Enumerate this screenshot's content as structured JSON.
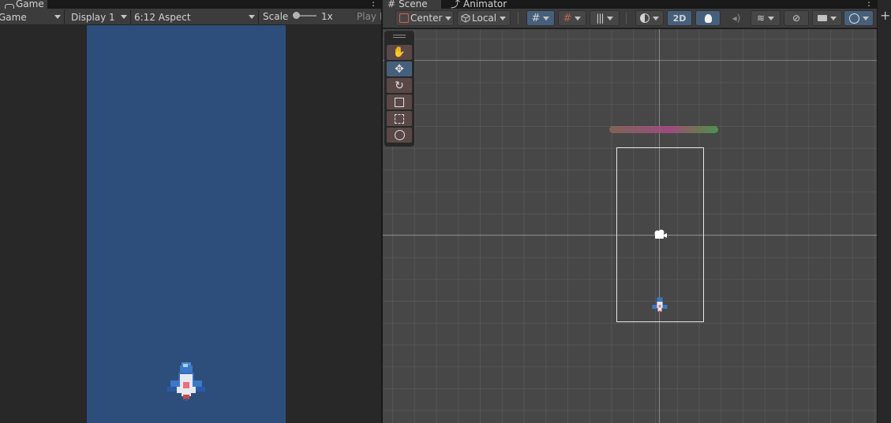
{
  "game": {
    "tab_label": "Game",
    "view_dropdown": "Game",
    "display_dropdown": "Display 1",
    "aspect_dropdown": "6:12 Aspect",
    "scale_label": "Scale",
    "scale_value": "1x",
    "scale_level": 0,
    "play_label": "Play F",
    "background_color": "#2d4e7a"
  },
  "scene": {
    "tabs": [
      {
        "label": "Scene",
        "icon": "grid-hash-icon",
        "active": true
      },
      {
        "label": "Animator",
        "icon": "animator-icon",
        "active": false
      }
    ],
    "pivot_dropdown": "Center",
    "space_dropdown": "Local",
    "mode_2d_label": "2D",
    "tools": [
      "hand-tool",
      "move-tool",
      "rotate-tool",
      "scale-tool",
      "rect-tool",
      "transform-tool"
    ],
    "active_tool": "move-tool",
    "toolbar_icons": [
      "grid-snap-icon",
      "snap-increment-icon",
      "vertex-snap-icon",
      "shading-icon",
      "lighting-icon",
      "audio-icon",
      "effects-icon",
      "hidden-objects-icon",
      "camera-icon",
      "gizmos-icon"
    ]
  },
  "colors": {
    "accent": "#46607c",
    "panel": "#282828",
    "toolbar": "#3c3c3c"
  }
}
